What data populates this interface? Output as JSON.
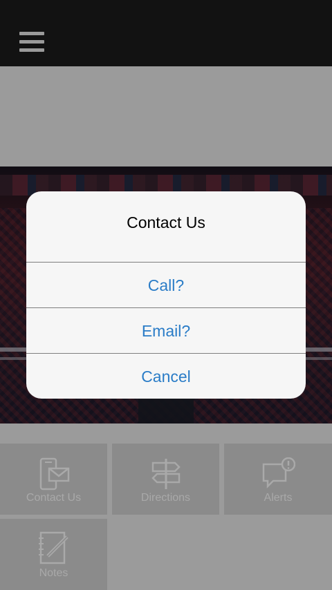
{
  "header": {
    "menu_icon": "hamburger-menu-icon"
  },
  "tiles": [
    {
      "label": "Contact Us",
      "icon": "phone-mail-icon"
    },
    {
      "label": "Directions",
      "icon": "signpost-icon"
    },
    {
      "label": "Alerts",
      "icon": "alert-bubble-icon"
    },
    {
      "label": "Notes",
      "icon": "notes-pencil-icon"
    }
  ],
  "dialog": {
    "title": "Contact Us",
    "options": [
      "Call?",
      "Email?",
      "Cancel"
    ]
  },
  "colors": {
    "topbar": "#121212",
    "background": "#9b9b9b",
    "tile": "#8b8b8b",
    "dialog_bg": "#f6f6f6",
    "accent": "#2a7cc7"
  }
}
